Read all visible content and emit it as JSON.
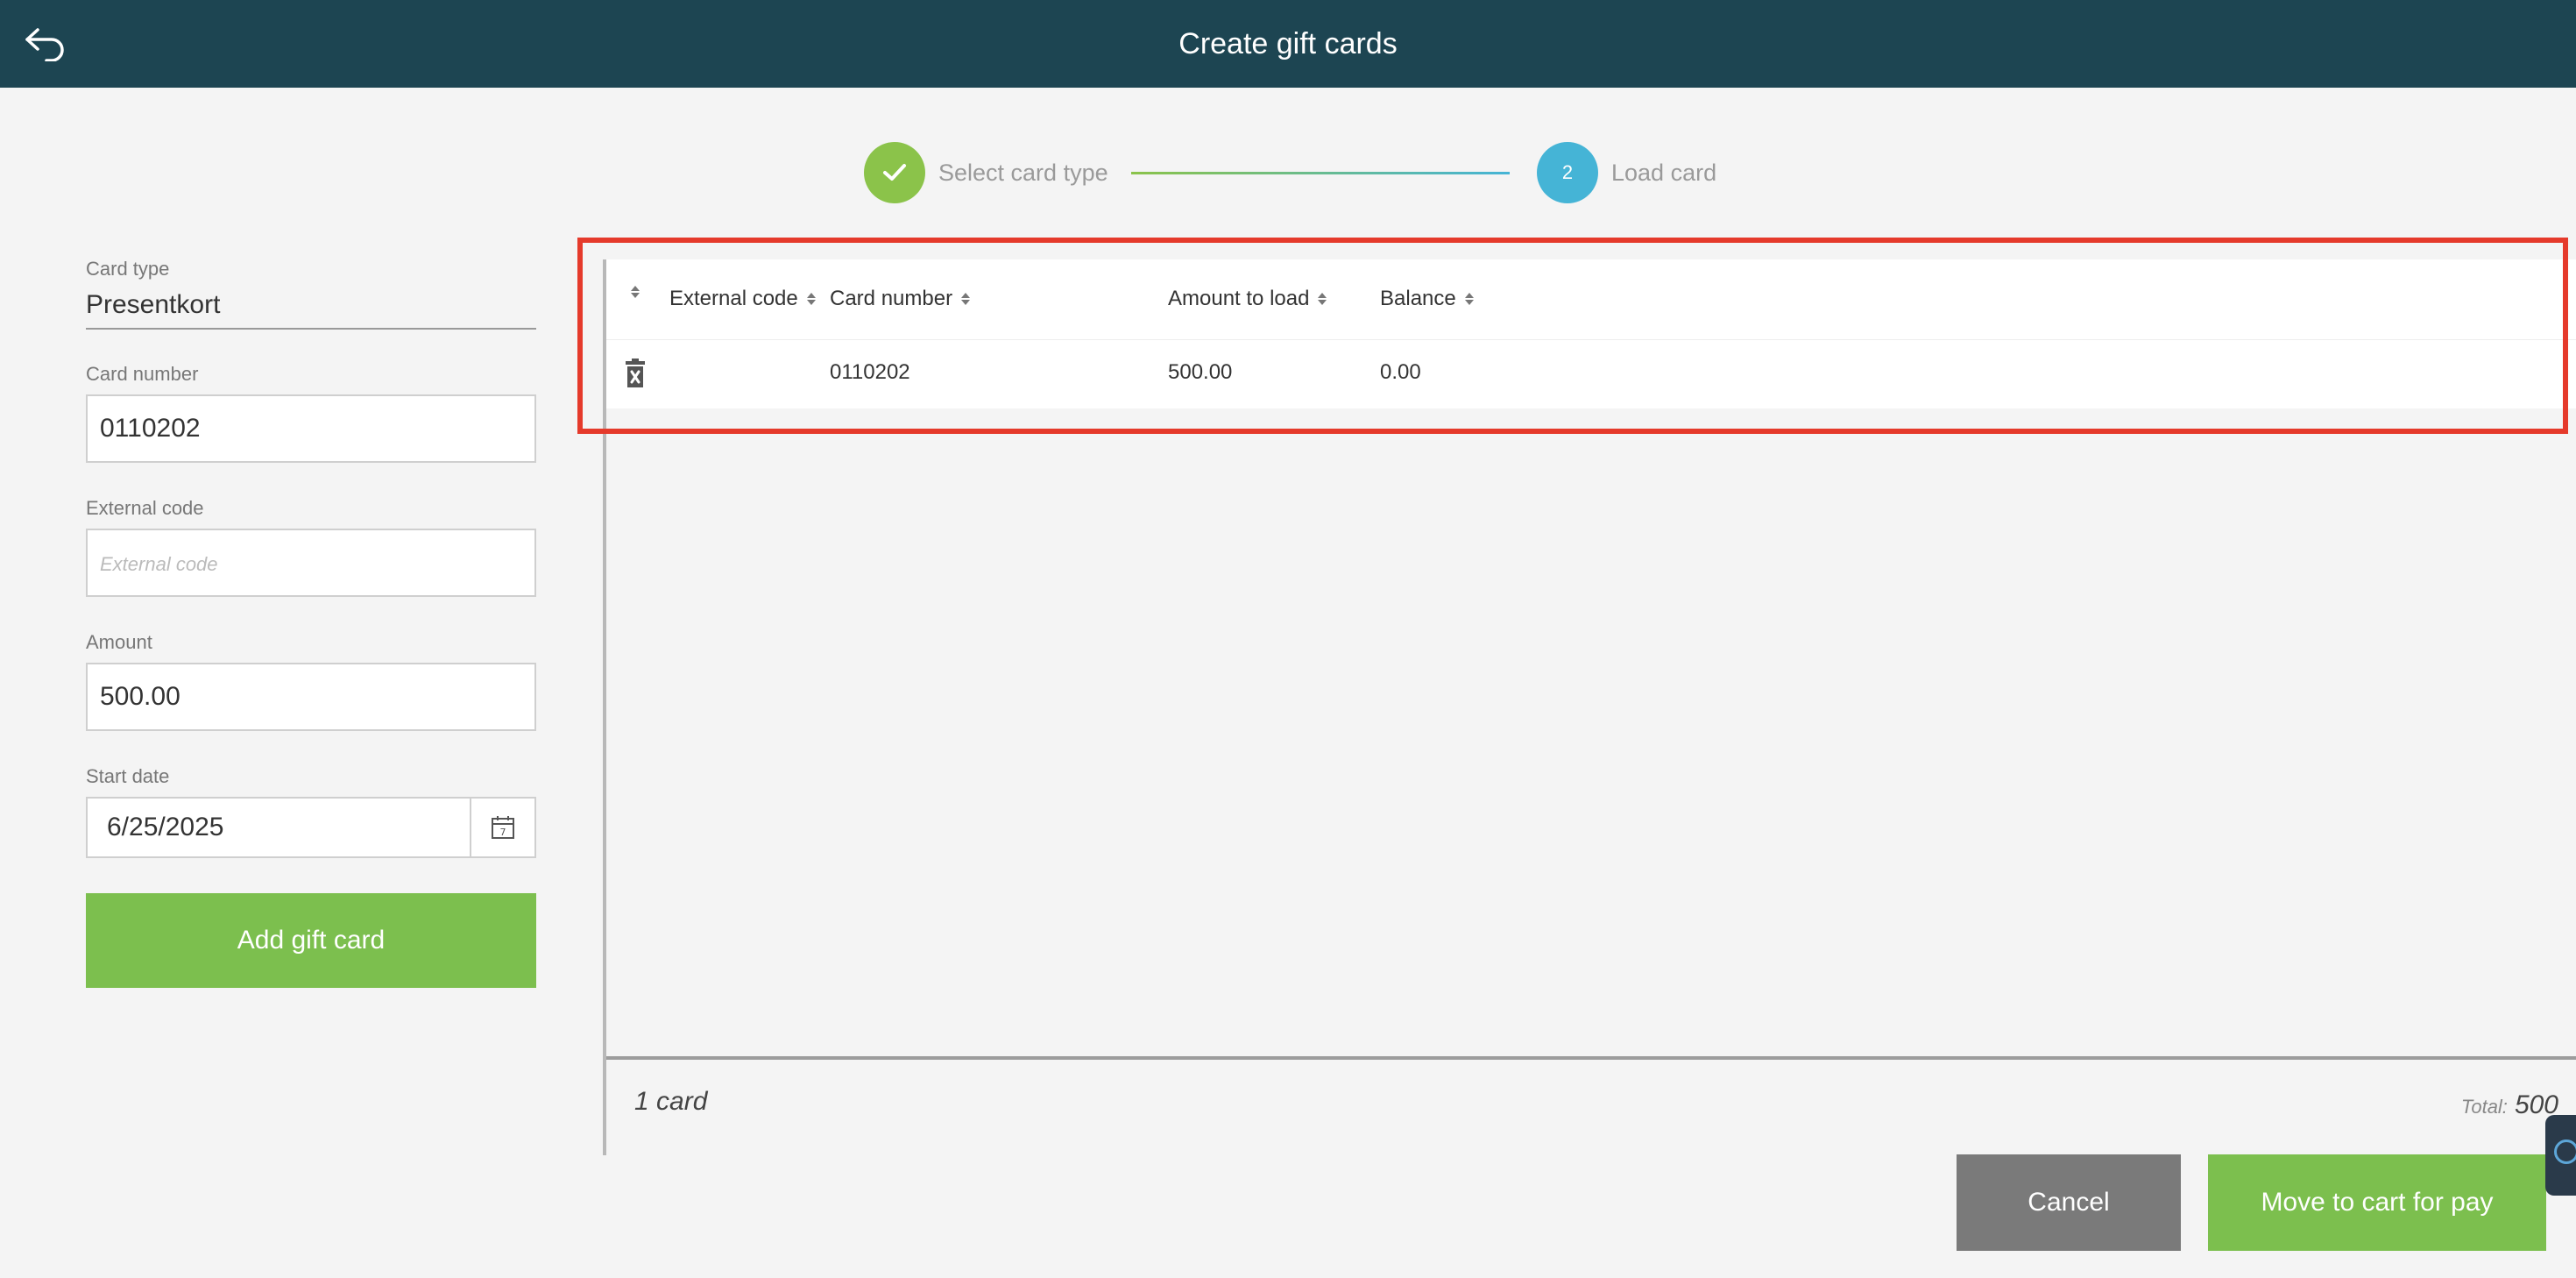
{
  "header": {
    "title": "Create gift cards",
    "back_icon": "back-arrow-icon"
  },
  "stepper": {
    "step1": {
      "label": "Select card type",
      "icon": "check-icon"
    },
    "step2": {
      "number": "2",
      "label": "Load card"
    }
  },
  "form": {
    "card_type": {
      "label": "Card type",
      "value": "Presentkort"
    },
    "card_number": {
      "label": "Card number",
      "value": "0110202"
    },
    "external_code": {
      "label": "External code",
      "placeholder": "External code",
      "value": ""
    },
    "amount": {
      "label": "Amount",
      "value": "500.00"
    },
    "start_date": {
      "label": "Start date",
      "value": "6/25/2025",
      "icon": "calendar-icon"
    },
    "add_button": "Add gift card"
  },
  "table": {
    "columns": [
      "External code",
      "Card number",
      "Amount to load",
      "Balance"
    ],
    "rows": [
      {
        "external_code": "",
        "card_number": "0110202",
        "amount_to_load": "500.00",
        "balance": "0.00"
      }
    ]
  },
  "footer": {
    "card_count": "1 card",
    "total_label": "Total:",
    "total_value": "500"
  },
  "actions": {
    "cancel": "Cancel",
    "move_to_cart": "Move to cart for pay"
  },
  "colors": {
    "header_bg": "#1d4552",
    "accent_green": "#7cbf4e",
    "step_blue": "#45b4d6",
    "highlight_red": "#e53a2b",
    "cancel_gray": "#7a7a7a"
  }
}
